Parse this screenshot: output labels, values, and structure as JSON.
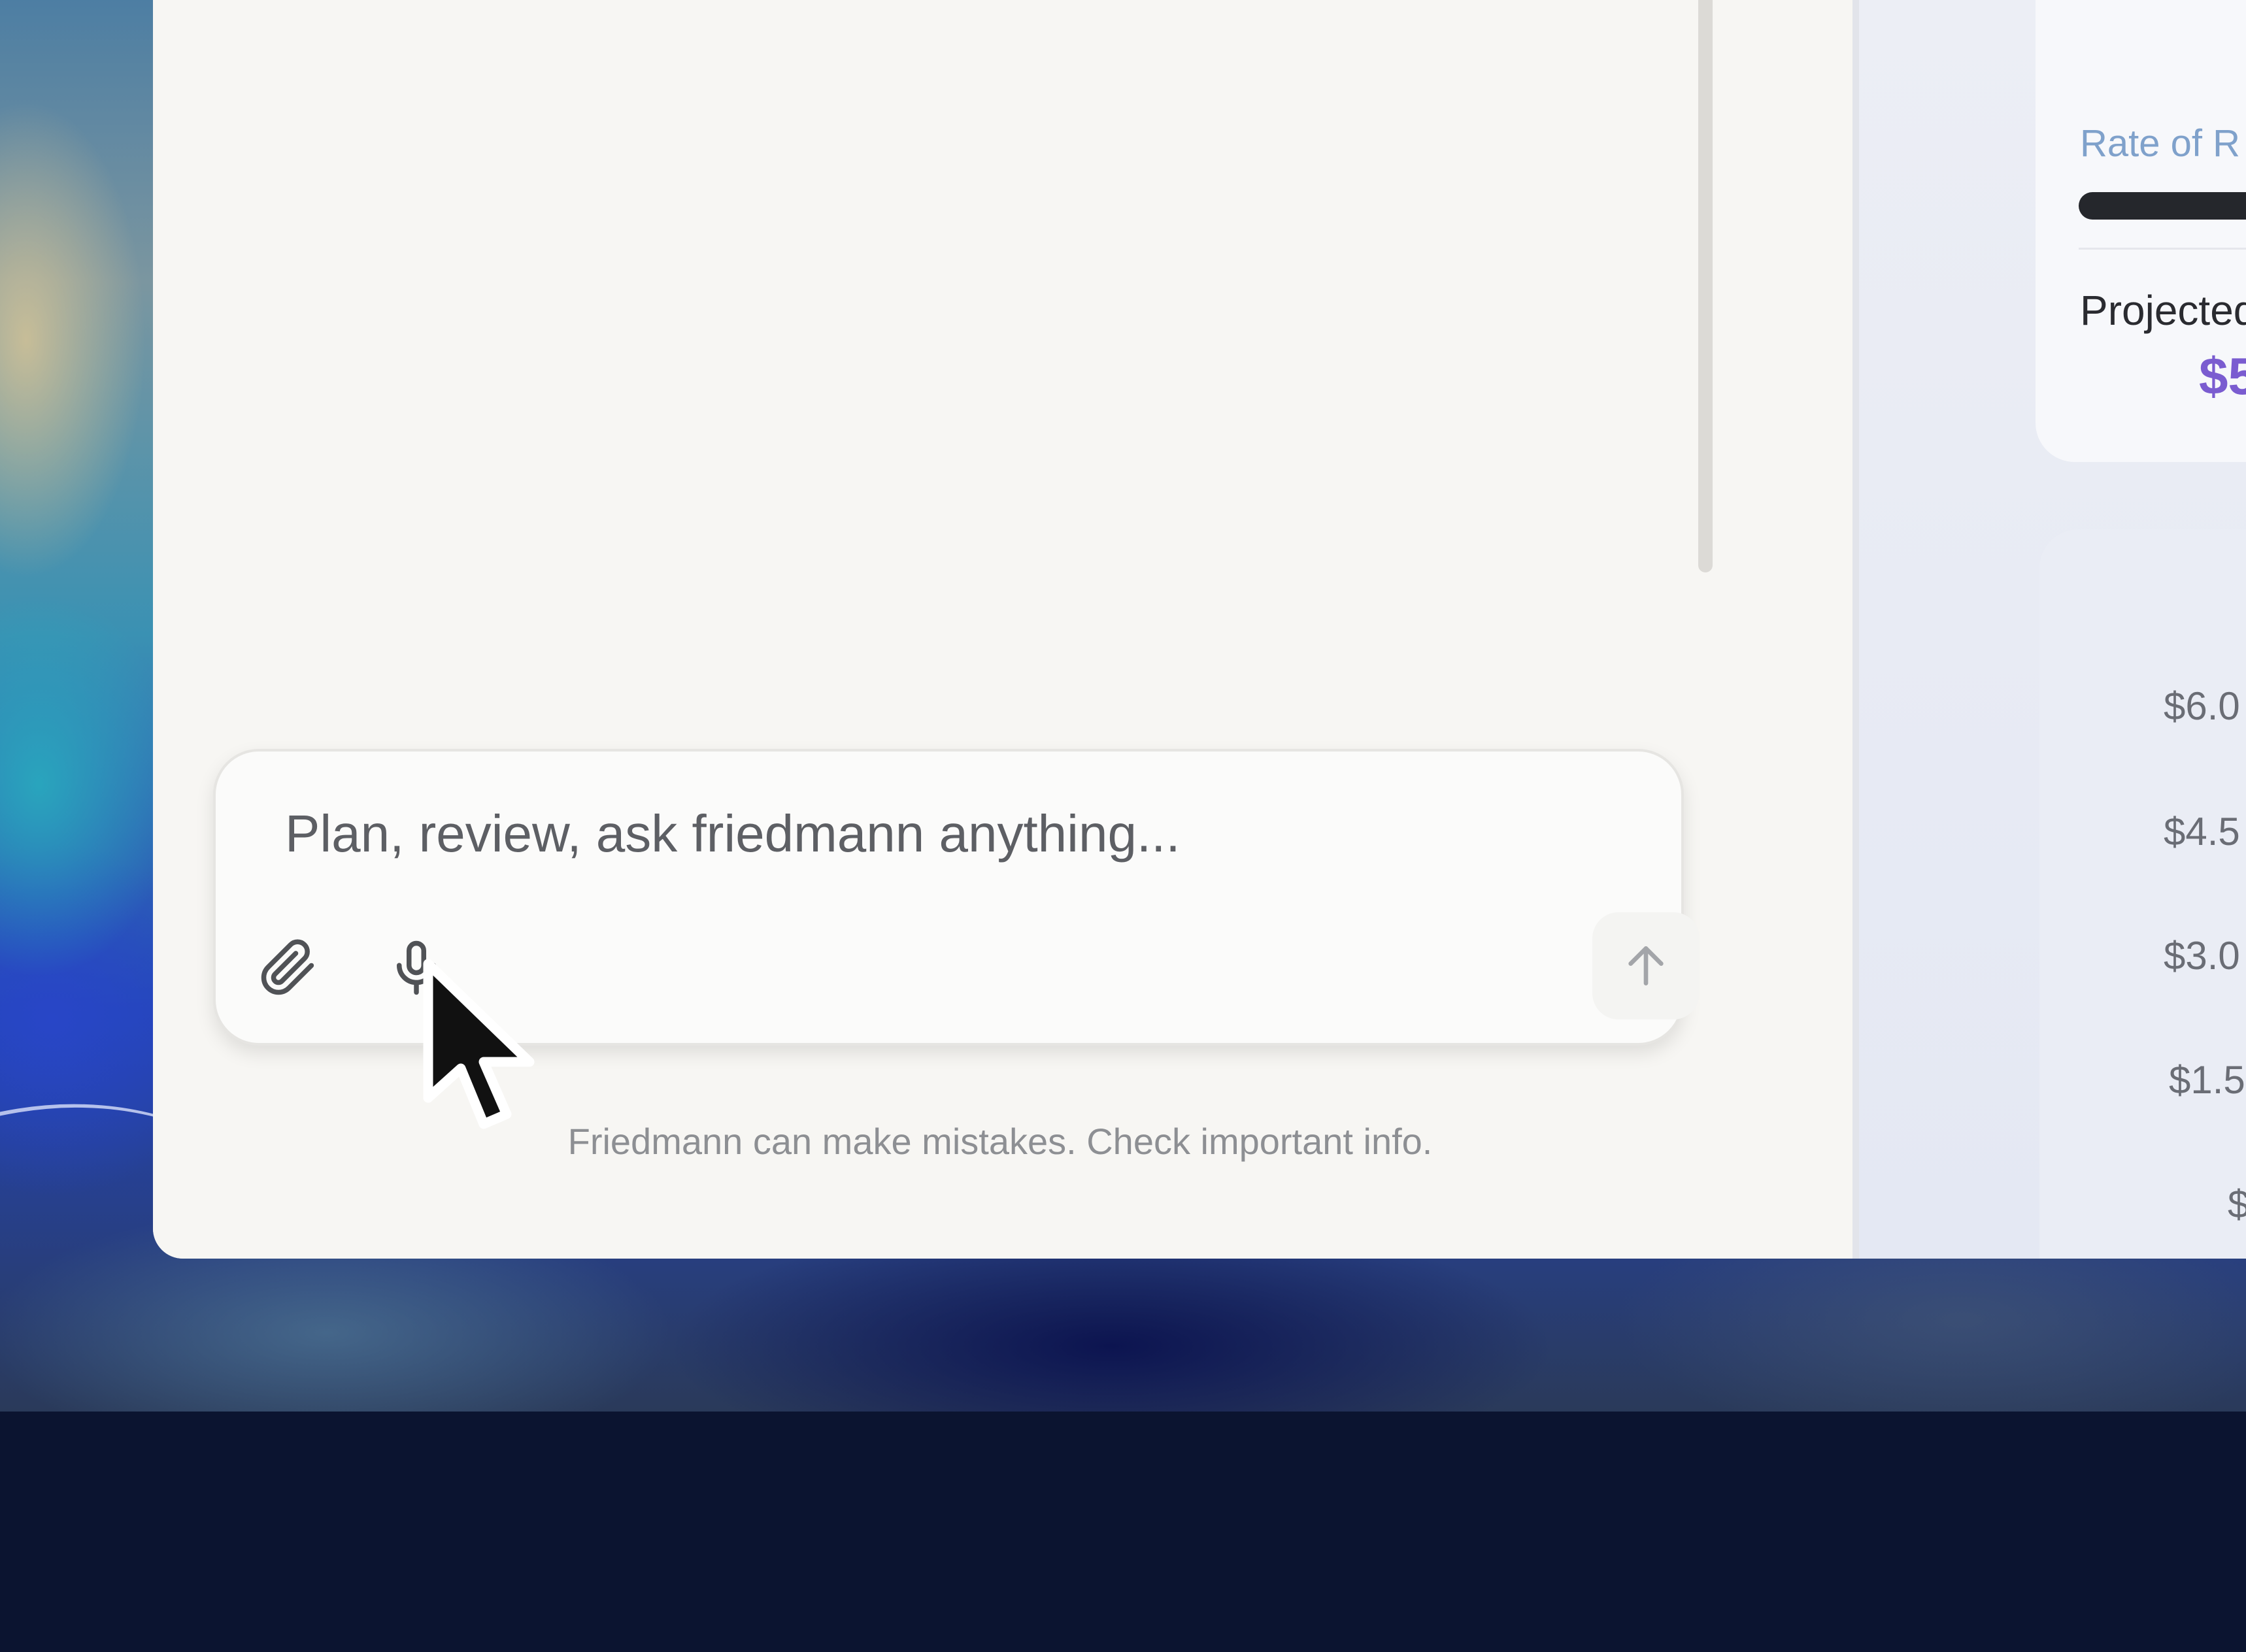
{
  "composer": {
    "placeholder": "Plan, review, ask friedmann anything...",
    "attach_icon": "paperclip-icon",
    "mic_icon": "microphone-icon",
    "send_icon": "arrow-up-icon"
  },
  "disclaimer": "Friedmann can make mistakes. Check important info.",
  "dashboard": {
    "rate_label": "Rate of R",
    "projected_label": "Projected",
    "projected_value": "$5",
    "axis_ticks": [
      "$6.0",
      "$4.5",
      "$3.0",
      "$1.5",
      "$"
    ]
  },
  "colors": {
    "accent_purple": "#7a5cd0",
    "label_blue": "#7fa1cb",
    "progress_bar": "#25272c"
  }
}
